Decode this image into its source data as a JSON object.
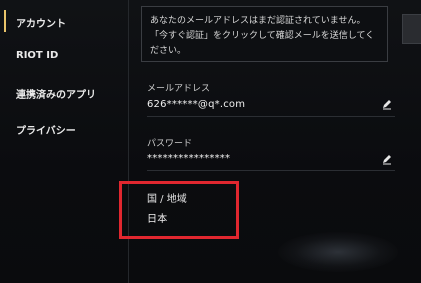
{
  "sidebar": {
    "items": [
      {
        "label": "アカウント",
        "active": true
      },
      {
        "label": "RIOT ID"
      },
      {
        "label": "連携済みのアプリ"
      },
      {
        "label": "プライバシー"
      }
    ]
  },
  "notice": {
    "line1": "あなたのメールアドレスはまだ認証されていません。",
    "line2": "「今すぐ認証」をクリックして確認メールを送信してく",
    "line3": "ださい。"
  },
  "email": {
    "label": "メールアドレス",
    "value": "626******@q*.com",
    "edit_icon": "pencil-icon"
  },
  "password": {
    "label": "パスワード",
    "value": "****************",
    "edit_icon": "pencil-icon"
  },
  "region": {
    "label": "国 / 地域",
    "value": "日本"
  },
  "colors": {
    "accent": "#e9c46a",
    "highlight": "#e0272f",
    "background": "#0b0c0e"
  }
}
